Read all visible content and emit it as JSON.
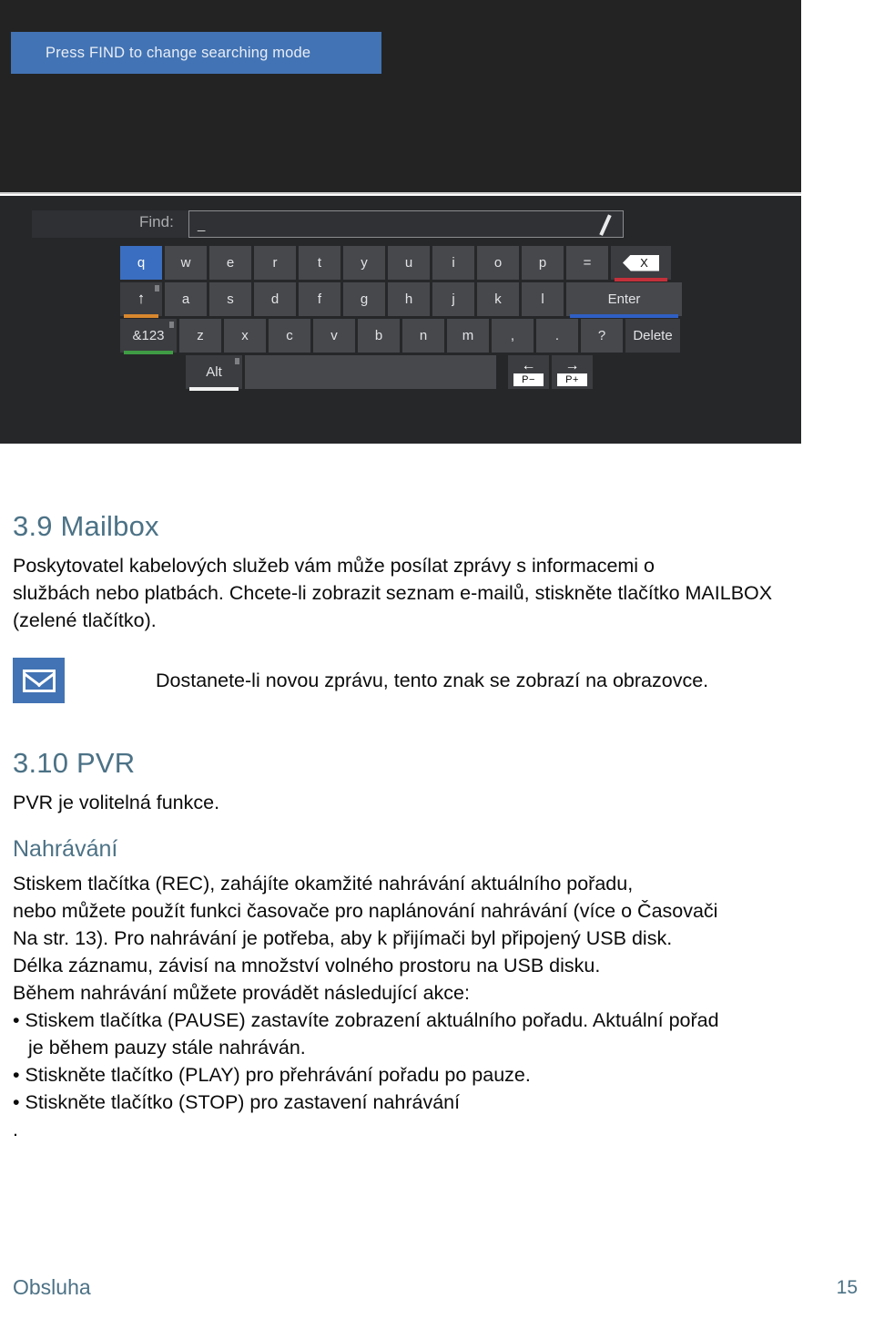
{
  "tv_screen": {
    "banner_text": "Press FIND to change searching mode",
    "find_label": "Find:",
    "find_value": "_",
    "pencil_icon": "pencil-icon",
    "keyboard": {
      "row1": [
        {
          "label": "q",
          "state": "active"
        },
        {
          "label": "w",
          "state": "normal"
        },
        {
          "label": "e",
          "state": "normal"
        },
        {
          "label": "r",
          "state": "normal"
        },
        {
          "label": "t",
          "state": "normal"
        },
        {
          "label": "y",
          "state": "normal"
        },
        {
          "label": "u",
          "state": "normal"
        },
        {
          "label": "i",
          "state": "normal"
        },
        {
          "label": "o",
          "state": "normal"
        },
        {
          "label": "p",
          "state": "normal"
        },
        {
          "label": "=",
          "state": "normal"
        }
      ],
      "backspace": {
        "name": "backspace-key",
        "glyph": "X",
        "accent": "#c4303a"
      },
      "row2": [
        {
          "label": "a"
        },
        {
          "label": "s"
        },
        {
          "label": "d"
        },
        {
          "label": "f"
        },
        {
          "label": "g"
        },
        {
          "label": "h"
        },
        {
          "label": "j"
        },
        {
          "label": "k"
        },
        {
          "label": "l"
        }
      ],
      "shift": {
        "name": "shift-key",
        "glyph": "↑",
        "accent": "#d8872e"
      },
      "enter": {
        "label": "Enter",
        "accent": "#2f5fc4"
      },
      "row3": [
        {
          "label": "z"
        },
        {
          "label": "x"
        },
        {
          "label": "c"
        },
        {
          "label": "v"
        },
        {
          "label": "b"
        },
        {
          "label": "n"
        },
        {
          "label": "m"
        },
        {
          "label": ","
        },
        {
          "label": "."
        },
        {
          "label": "?"
        }
      ],
      "symbols": {
        "label": "&123",
        "accent": "#3f9c45"
      },
      "delete": {
        "label": "Delete"
      },
      "alt": {
        "label": "Alt",
        "accent": "#f2f2f2"
      },
      "space": {
        "label": ""
      },
      "prev": {
        "glyph": "←",
        "label": "P−"
      },
      "next": {
        "glyph": "→",
        "label": "P+"
      }
    }
  },
  "document": {
    "section_mailbox": {
      "heading": "3.9 Mailbox",
      "paragraph_lines": [
        "Poskytovatel kabelových služeb vám může posílat zprávy s informacemi o",
        "službách nebo platbách. Chcete-li zobrazit seznam e-mailů, stiskněte tlačítko MAILBOX",
        "(zelené tlačítko)."
      ],
      "mail_icon": "mail-envelope-icon",
      "mail_note": "Dostanete-li novou zprávu, tento znak se zobrazí na obrazovce."
    },
    "section_pvr": {
      "heading": "3.10 PVR",
      "intro": "PVR je volitelná funkce.",
      "subheading": "Nahrávání",
      "body_lines": [
        "Stiskem tlačítka (REC), zahájíte okamžité nahrávání aktuálního pořadu,",
        "nebo můžete použít funkci časovače pro naplánování nahrávání (více o Časovači",
        "Na str. 13). Pro nahrávání je potřeba, aby k přijímači byl připojený USB disk.",
        "Délka záznamu, závisí na množství volného prostoru na USB disku.",
        " Během nahrávání můžete provádět následující akce:",
        "• Stiskem tlačítka (PAUSE) zastavíte zobrazení aktuálního pořadu. Aktuální pořad",
        "je během pauzy stále nahráván.",
        "• Stiskněte tlačítko (PLAY) pro přehrávání pořadu po pauze.",
        "• Stiskněte tlačítko (STOP) pro zastavení nahrávání",
        "."
      ]
    }
  },
  "footer": {
    "left": "Obsluha",
    "page_number": "15"
  },
  "colors": {
    "accent_heading": "#4c7286",
    "banner_blue": "#4273b4",
    "key_active": "#3a6ec0",
    "tv_bg_upper": "#232323",
    "tv_bg_lower": "#262729"
  }
}
